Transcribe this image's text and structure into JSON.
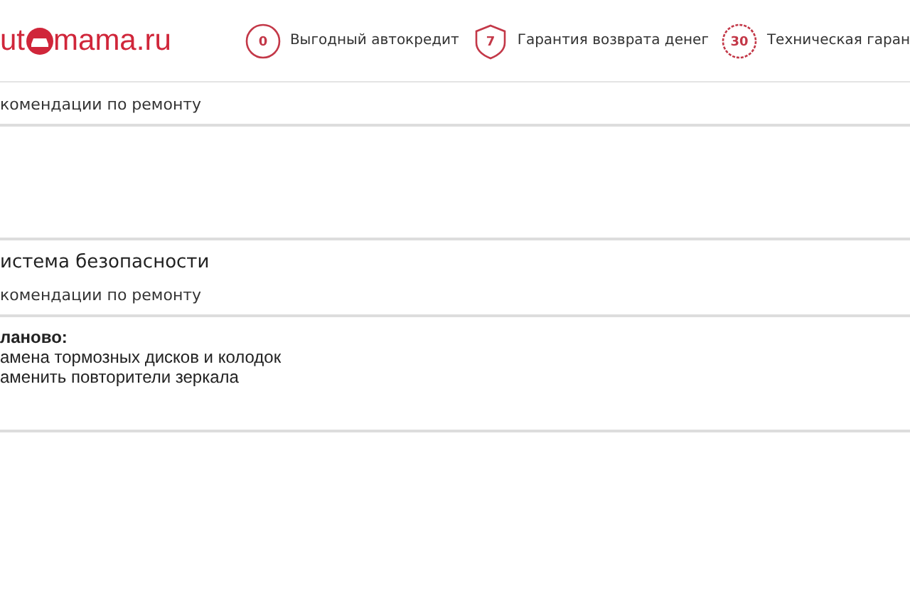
{
  "header": {
    "logo": {
      "before": "ut",
      "after": "mama.ru"
    },
    "features": [
      {
        "kind": "circle",
        "badge": "0",
        "label": "Выгодный автокредит"
      },
      {
        "kind": "shield",
        "badge": "7",
        "label": "Гарантия возврата денег"
      },
      {
        "kind": "seal",
        "badge": "30",
        "label": "Техническая гаран"
      }
    ]
  },
  "sections": [
    {
      "subtitle": "комендации по ремонту"
    },
    {
      "title": "истема безопасности",
      "subtitle": "комендации по ремонту",
      "heading": "ланово:",
      "lines": [
        "амена тормозных дисков и колодок",
        "аменить повторители зеркала"
      ]
    }
  ]
}
